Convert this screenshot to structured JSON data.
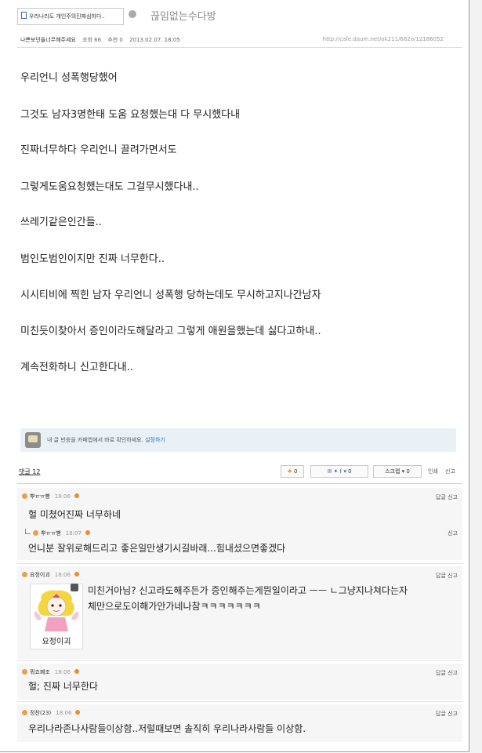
{
  "tab": {
    "label": "우리나라도 개인주의진짜심하다.."
  },
  "board": {
    "name": "끊임없는수다방"
  },
  "meta": {
    "author": "나쁜보던들너무해주세요",
    "views": "조회 66",
    "recommends": "추천 0",
    "date": "2013.02.07. 18:05",
    "url": "http://cafe.daum.net/ok211/682o/12186052"
  },
  "body": [
    "우리언니 성폭행당했어",
    "그것도 남자3명한태 도움 요청했는대 다 무시했다내",
    "진짜너무하다 우리언니 끌려가면서도",
    "그렇게도움요청했는대도 그걸무시했다내..",
    "쓰레기같은인간들..",
    "범인도범인이지만 진짜 너무한다..",
    "시시티비에 찍힌 남자 우리언니 성폭행 당하는데도 무시하고지나간남자",
    "미친듯이찾아서 증인이라도해달라고 그렇게 애원을했는데 싫다고하내..",
    "계속전화하니 신고한다내.."
  ],
  "notice": {
    "text": "내 글 반응을 카페앱에서 바로 확인하세요.",
    "link": "설정하기"
  },
  "comments_bar": {
    "count_label": "댓글 12",
    "like_label": "0",
    "share_count": "0",
    "scrap_label": "스크랩",
    "scrap_count": "0",
    "print_label": "인쇄",
    "report_label": "신고"
  },
  "comments": [
    {
      "author": "뿌ㅠㅠ빵",
      "time": "18:06",
      "text": "헐 미쳤어진짜 너무하네",
      "actions": "답글 신고"
    },
    {
      "author": "뿌ㅠㅠ빵",
      "time": "18:07",
      "text": "언니분 잘위로해드리고 좋은일만생기시길바래...힘내셨으면좋겠다",
      "actions": "신고"
    },
    {
      "author": "요정이괴",
      "time": "18:06",
      "text1": "미친거아님? 신고라도해주든가 증인해주는게뭔일이라고 ㅡㅡ ㄴ그냥지나쳐다는자",
      "text2": "체만으로도이해가안가네나참ㅋㅋㅋㅋㅋㅋㅋ",
      "actions": "답글 신고",
      "sticker_text": "요정이괴"
    },
    {
      "author": "뭐죠폐조",
      "time": "18:06",
      "text": "헐; 진짜 너무한다",
      "actions": "답글 신고"
    },
    {
      "author": "정찬(23)",
      "time": "18:06",
      "text": "우리나라존나사람들이상함..저럴때보면 솔직히 우리나라사람들 이상함.",
      "actions": "답글 신고"
    }
  ]
}
